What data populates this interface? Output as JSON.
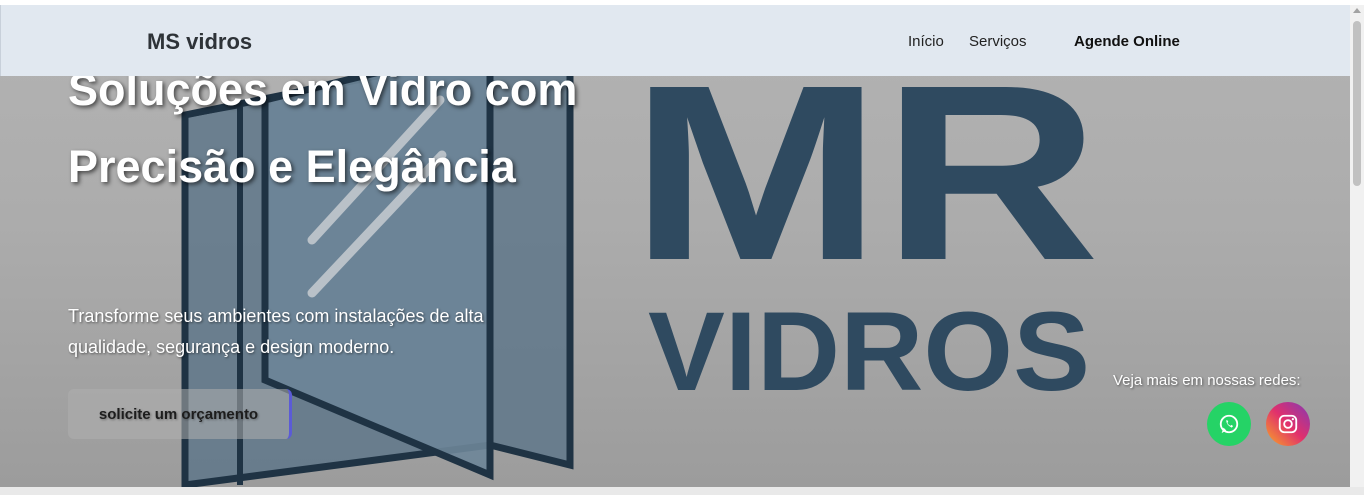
{
  "header": {
    "brand": "MS vidros",
    "nav": [
      {
        "label": "Início"
      },
      {
        "label": "Serviços"
      },
      {
        "label": "Agende Online"
      }
    ]
  },
  "hero": {
    "title": "Soluções em Vidro com Precisão e Elegância",
    "subtitle": "Transforme seus ambientes com instalações de alta qualidade, segurança e design moderno.",
    "cta_label": "solicite um orçamento",
    "background_logo": {
      "line1": "MR",
      "line2": "VIDROS",
      "color": "#2f4a60"
    }
  },
  "social": {
    "label": "Veja mais em nossas redes:",
    "links": [
      {
        "name": "whatsapp",
        "icon": "whatsapp-icon",
        "color": "#25d366"
      },
      {
        "name": "instagram",
        "icon": "instagram-icon",
        "color": "#e1306c"
      }
    ]
  },
  "colors": {
    "navbar": "#e1e8f0",
    "hero_overlay": "#acacac",
    "logo": "#2f4a60"
  }
}
